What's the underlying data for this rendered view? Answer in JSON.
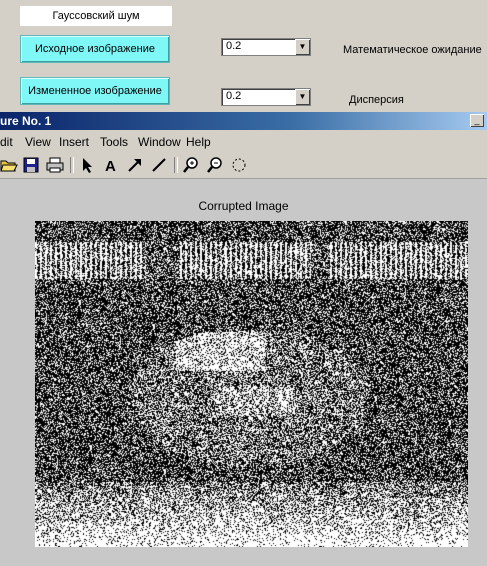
{
  "panel": {
    "noise_label": "Гауссовский шум",
    "original_button": "Исходное изображение",
    "modified_button": "Измененное изображение",
    "mean_value": "0.2",
    "variance_value": "0.2",
    "mean_label": "Математическое ожидание",
    "variance_label": "Дисперсия"
  },
  "figure": {
    "title": "ure No. 1",
    "menu": [
      "dit",
      "View",
      "Insert",
      "Tools",
      "Window",
      "Help"
    ],
    "toolbar_icons": [
      "open-icon",
      "save-icon",
      "print-icon",
      "select-arrow-icon",
      "text-icon",
      "arrow-icon",
      "line-icon",
      "zoom-in-icon",
      "zoom-out-icon",
      "rotate-icon"
    ],
    "image_title": "Corrupted Image"
  },
  "colors": {
    "button_cyan": "#7ff7f7",
    "titlebar": "#0a246a",
    "panel_gray": "#d4d0c8"
  }
}
